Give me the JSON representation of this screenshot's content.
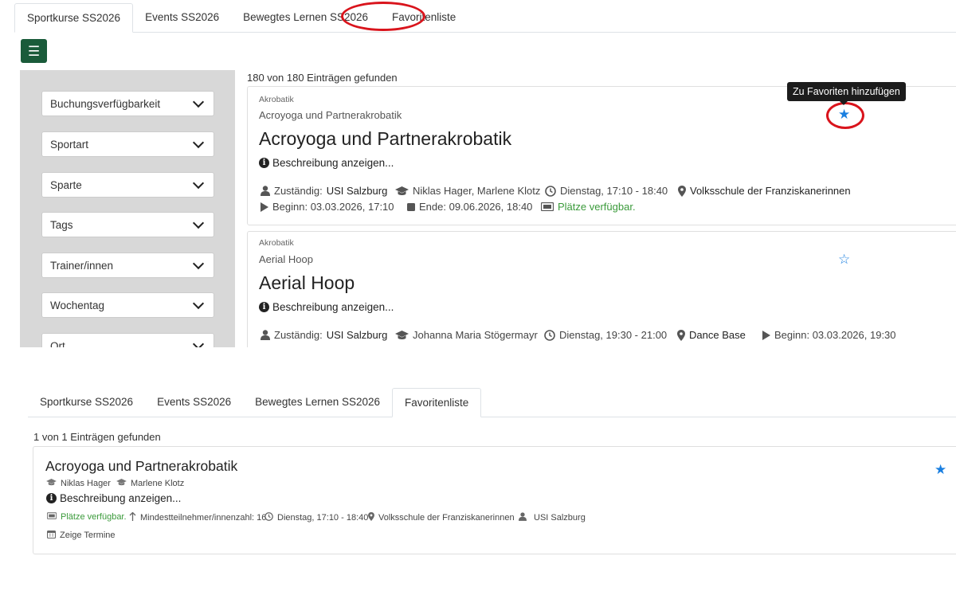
{
  "top": {
    "tabs": [
      "Sportkurse SS2026",
      "Events SS2026",
      "Bewegtes Lernen SS2026",
      "Favoritenliste"
    ],
    "active_tab": "Sportkurse SS2026",
    "menu_icon": "☰",
    "filters": [
      "Buchungsverfügbarkeit",
      "Sportart",
      "Sparte",
      "Tags",
      "Trainer/innen",
      "Wochentag",
      "Ort"
    ],
    "result_count": "180 von 180 Einträgen gefunden",
    "tooltip": "Zu Favoriten hinzufügen",
    "cards": [
      {
        "category": "Akrobatik",
        "subtitle": "Acroyoga und Partnerakrobatik",
        "title": "Acroyoga und Partnerakrobatik",
        "description_link": "Beschreibung anzeigen...",
        "responsible_label": "Zuständig:",
        "responsible": "USI Salzburg",
        "trainers": "Niklas Hager, Marlene Klotz",
        "schedule": "Dienstag, 17:10 - 18:40",
        "location": "Volksschule der Franziskanerinnen",
        "start": "Beginn: 03.03.2026, 17:10",
        "end": "Ende: 09.06.2026, 18:40",
        "availability": "Plätze verfügbar."
      },
      {
        "category": "Akrobatik",
        "subtitle": "Aerial Hoop",
        "title": "Aerial Hoop",
        "description_link": "Beschreibung anzeigen...",
        "responsible_label": "Zuständig:",
        "responsible": "USI Salzburg",
        "trainers": "Johanna Maria Stögermayr",
        "schedule": "Dienstag, 19:30 - 21:00",
        "location": "Dance Base",
        "start": "Beginn: 03.03.2026, 19:30"
      }
    ]
  },
  "bottom": {
    "tabs": [
      "Sportkurse SS2026",
      "Events SS2026",
      "Bewegtes Lernen SS2026",
      "Favoritenliste"
    ],
    "active_tab": "Favoritenliste",
    "result_count": "1 von 1 Einträgen gefunden",
    "favorite": {
      "title": "Acroyoga und Partnerakrobatik",
      "trainer_1": "Niklas Hager",
      "trainer_2": "Marlene Klotz",
      "description_link": "Beschreibung anzeigen...",
      "availability": "Plätze verfügbar.",
      "min_participants": "Mindestteilnehmer/innenzahl: 16",
      "schedule": "Dienstag, 17:10 - 18:40",
      "location": "Volksschule der Franziskanerinnen",
      "organizer": "USI Salzburg",
      "show_dates": "Zeige Termine"
    }
  },
  "colors": {
    "highlight_ring": "#d9141c",
    "star": "#1a7fe0",
    "menu_button": "#1a5b3a",
    "available_green": "#3a9a3a"
  },
  "icons": [
    "menu-icon",
    "chevron-down-icon",
    "info-icon",
    "user-icon",
    "graduation-cap-icon",
    "clock-icon",
    "map-marker-icon",
    "play-icon",
    "stop-icon",
    "ticket-icon",
    "star-icon",
    "arrow-up-icon",
    "calendar-icon"
  ]
}
